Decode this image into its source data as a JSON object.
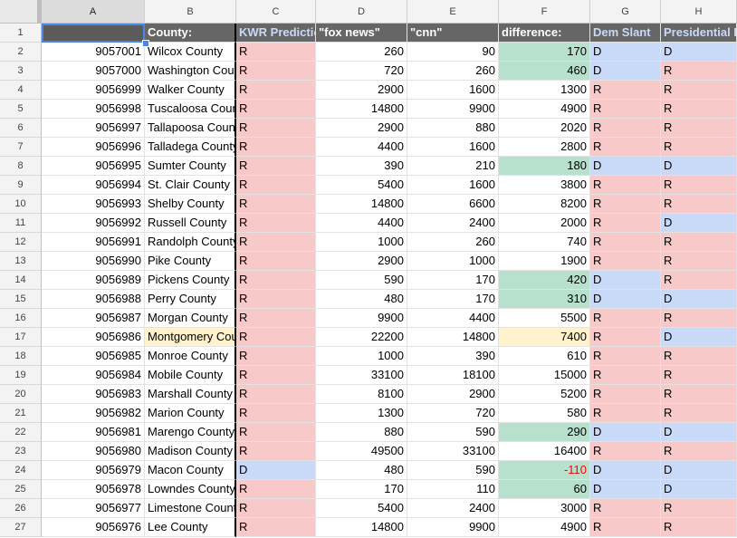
{
  "columns": [
    "A",
    "B",
    "C",
    "D",
    "E",
    "F",
    "G",
    "H"
  ],
  "selected_column": "A",
  "header_row": {
    "row_num": "1",
    "A": "",
    "B": "County:",
    "C": "KWR Prediction",
    "D": "\"fox news\"",
    "E": "\"cnn\"",
    "F": "difference:",
    "G": "Dem Slant",
    "H": "Presidential Result"
  },
  "colors": {
    "republican": "#f8c9c9",
    "democrat": "#c9daf8",
    "positive_diff": "#b7e1cd",
    "highlight": "#fff2cc",
    "negative_text": "#ff0000"
  },
  "rows": [
    {
      "n": "2",
      "id": "9057001",
      "county": "Wilcox County",
      "kwr": "R",
      "fox": "260",
      "cnn": "90",
      "diff": "170",
      "slant": "D",
      "pres": "D"
    },
    {
      "n": "3",
      "id": "9057000",
      "county": "Washington County",
      "kwr": "R",
      "fox": "720",
      "cnn": "260",
      "diff": "460",
      "slant": "D",
      "pres": "R"
    },
    {
      "n": "4",
      "id": "9056999",
      "county": "Walker County",
      "kwr": "R",
      "fox": "2900",
      "cnn": "1600",
      "diff": "1300",
      "slant": "R",
      "pres": "R"
    },
    {
      "n": "5",
      "id": "9056998",
      "county": "Tuscaloosa County",
      "kwr": "R",
      "fox": "14800",
      "cnn": "9900",
      "diff": "4900",
      "slant": "R",
      "pres": "R"
    },
    {
      "n": "6",
      "id": "9056997",
      "county": "Tallapoosa County",
      "kwr": "R",
      "fox": "2900",
      "cnn": "880",
      "diff": "2020",
      "slant": "R",
      "pres": "R"
    },
    {
      "n": "7",
      "id": "9056996",
      "county": "Talladega County",
      "kwr": "R",
      "fox": "4400",
      "cnn": "1600",
      "diff": "2800",
      "slant": "R",
      "pres": "R"
    },
    {
      "n": "8",
      "id": "9056995",
      "county": "Sumter County",
      "kwr": "R",
      "fox": "390",
      "cnn": "210",
      "diff": "180",
      "slant": "D",
      "pres": "D"
    },
    {
      "n": "9",
      "id": "9056994",
      "county": "St. Clair County",
      "kwr": "R",
      "fox": "5400",
      "cnn": "1600",
      "diff": "3800",
      "slant": "R",
      "pres": "R"
    },
    {
      "n": "10",
      "id": "9056993",
      "county": "Shelby County",
      "kwr": "R",
      "fox": "14800",
      "cnn": "6600",
      "diff": "8200",
      "slant": "R",
      "pres": "R"
    },
    {
      "n": "11",
      "id": "9056992",
      "county": "Russell County",
      "kwr": "R",
      "fox": "4400",
      "cnn": "2400",
      "diff": "2000",
      "slant": "R",
      "pres": "D"
    },
    {
      "n": "12",
      "id": "9056991",
      "county": "Randolph County",
      "kwr": "R",
      "fox": "1000",
      "cnn": "260",
      "diff": "740",
      "slant": "R",
      "pres": "R"
    },
    {
      "n": "13",
      "id": "9056990",
      "county": "Pike County",
      "kwr": "R",
      "fox": "2900",
      "cnn": "1000",
      "diff": "1900",
      "slant": "R",
      "pres": "R"
    },
    {
      "n": "14",
      "id": "9056989",
      "county": "Pickens County",
      "kwr": "R",
      "fox": "590",
      "cnn": "170",
      "diff": "420",
      "slant": "D",
      "pres": "R"
    },
    {
      "n": "15",
      "id": "9056988",
      "county": "Perry County",
      "kwr": "R",
      "fox": "480",
      "cnn": "170",
      "diff": "310",
      "slant": "D",
      "pres": "D"
    },
    {
      "n": "16",
      "id": "9056987",
      "county": "Morgan County",
      "kwr": "R",
      "fox": "9900",
      "cnn": "4400",
      "diff": "5500",
      "slant": "R",
      "pres": "R"
    },
    {
      "n": "17",
      "id": "9056986",
      "county": "Montgomery County",
      "kwr": "R",
      "fox": "22200",
      "cnn": "14800",
      "diff": "7400",
      "slant": "R",
      "pres": "D",
      "hl": true
    },
    {
      "n": "18",
      "id": "9056985",
      "county": "Monroe County",
      "kwr": "R",
      "fox": "1000",
      "cnn": "390",
      "diff": "610",
      "slant": "R",
      "pres": "R"
    },
    {
      "n": "19",
      "id": "9056984",
      "county": "Mobile County",
      "kwr": "R",
      "fox": "33100",
      "cnn": "18100",
      "diff": "15000",
      "slant": "R",
      "pres": "R"
    },
    {
      "n": "20",
      "id": "9056983",
      "county": "Marshall County",
      "kwr": "R",
      "fox": "8100",
      "cnn": "2900",
      "diff": "5200",
      "slant": "R",
      "pres": "R"
    },
    {
      "n": "21",
      "id": "9056982",
      "county": "Marion County",
      "kwr": "R",
      "fox": "1300",
      "cnn": "720",
      "diff": "580",
      "slant": "R",
      "pres": "R"
    },
    {
      "n": "22",
      "id": "9056981",
      "county": "Marengo County",
      "kwr": "R",
      "fox": "880",
      "cnn": "590",
      "diff": "290",
      "slant": "D",
      "pres": "D"
    },
    {
      "n": "23",
      "id": "9056980",
      "county": "Madison County",
      "kwr": "R",
      "fox": "49500",
      "cnn": "33100",
      "diff": "16400",
      "slant": "R",
      "pres": "R"
    },
    {
      "n": "24",
      "id": "9056979",
      "county": "Macon County",
      "kwr": "D",
      "fox": "480",
      "cnn": "590",
      "diff": "-110",
      "slant": "D",
      "pres": "D"
    },
    {
      "n": "25",
      "id": "9056978",
      "county": "Lowndes County",
      "kwr": "R",
      "fox": "170",
      "cnn": "110",
      "diff": "60",
      "slant": "D",
      "pres": "D"
    },
    {
      "n": "26",
      "id": "9056977",
      "county": "Limestone County",
      "kwr": "R",
      "fox": "5400",
      "cnn": "2400",
      "diff": "3000",
      "slant": "R",
      "pres": "R"
    },
    {
      "n": "27",
      "id": "9056976",
      "county": "Lee County",
      "kwr": "R",
      "fox": "14800",
      "cnn": "9900",
      "diff": "4900",
      "slant": "R",
      "pres": "R"
    }
  ]
}
